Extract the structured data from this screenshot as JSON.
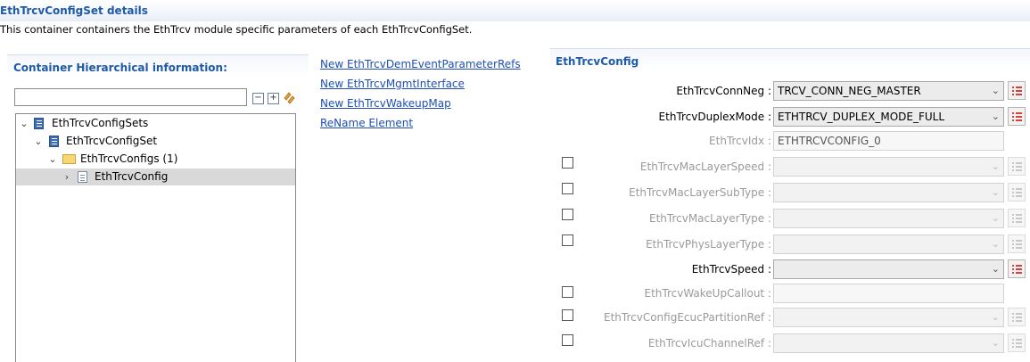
{
  "header": {
    "title": "EthTrcvConfigSet details",
    "description": "This container containers the EthTrcv module specific parameters of each EthTrcvConfigSet."
  },
  "hierarchy": {
    "title": "Container Hierarchical information:",
    "filter_value": "",
    "tree": [
      {
        "label": "EthTrcvConfigSets",
        "chevron": "⌄",
        "icon": "book"
      },
      {
        "label": "EthTrcvConfigSet",
        "chevron": "⌄",
        "icon": "book"
      },
      {
        "label": "EthTrcvConfigs (1)",
        "chevron": "⌄",
        "icon": "folder"
      },
      {
        "label": "EthTrcvConfig",
        "chevron": "›",
        "icon": "doc",
        "selected": true
      }
    ]
  },
  "links": [
    "New EthTrcvDemEventParameterRefs",
    "New EthTrcvMgmtInterface",
    "New EthTrcvWakeupMap",
    "ReName Element"
  ],
  "config": {
    "title": "EthTrcvConfig",
    "fields": [
      {
        "label": "EthTrcvConnNeg :",
        "value": "TRCV_CONN_NEG_MASTER",
        "kind": "combo",
        "enabled": true,
        "checkbox": false
      },
      {
        "label": "EthTrcvDuplexMode :",
        "value": "ETHTRCV_DUPLEX_MODE_FULL",
        "kind": "combo",
        "enabled": true,
        "checkbox": false
      },
      {
        "label": "EthTrcvIdx :",
        "value": "ETHTRCVCONFIG_0",
        "kind": "text",
        "enabled": false,
        "checkbox": false
      },
      {
        "label": "EthTrcvMacLayerSpeed :",
        "value": "",
        "kind": "combo",
        "enabled": false,
        "checkbox": true
      },
      {
        "label": "EthTrcvMacLayerSubType :",
        "value": "",
        "kind": "combo",
        "enabled": false,
        "checkbox": true
      },
      {
        "label": "EthTrcvMacLayerType :",
        "value": "",
        "kind": "combo",
        "enabled": false,
        "checkbox": true
      },
      {
        "label": "EthTrcvPhysLayerType :",
        "value": "",
        "kind": "combo",
        "enabled": false,
        "checkbox": true
      },
      {
        "label": "EthTrcvSpeed :",
        "value": "",
        "kind": "combo",
        "enabled": true,
        "checkbox": false
      },
      {
        "label": "EthTrcvWakeUpCallout :",
        "value": "",
        "kind": "text",
        "enabled": false,
        "checkbox": true
      },
      {
        "label": "EthTrcvConfigEcucPartitionRef :",
        "value": "",
        "kind": "combo",
        "enabled": false,
        "checkbox": true
      },
      {
        "label": "EthTrcvIcuChannelRef :",
        "value": "",
        "kind": "combo",
        "enabled": false,
        "checkbox": true
      }
    ]
  },
  "colors": {
    "accent": "#1e5aa8",
    "link": "#1f4fb4",
    "list_icon": "#d9403a",
    "selection": "#d9d9d9"
  }
}
